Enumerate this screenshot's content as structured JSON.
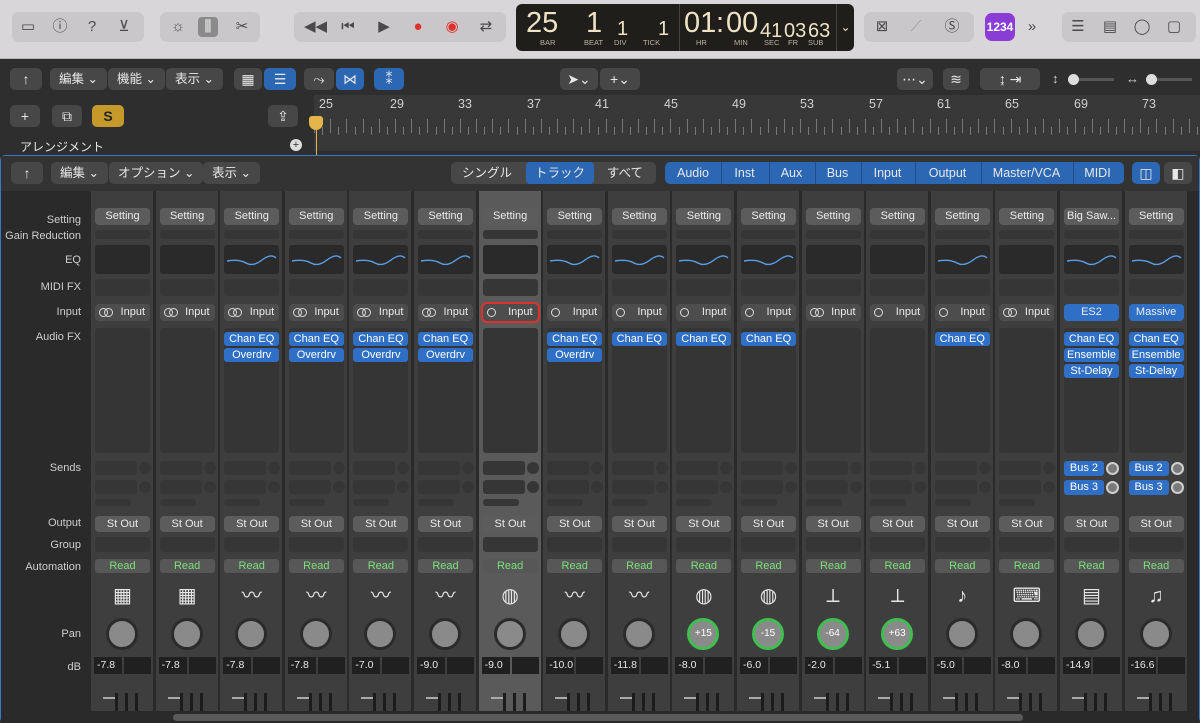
{
  "toolbar": {
    "lcd": {
      "bar": "25",
      "beat": "1",
      "div": "1",
      "tick": "1",
      "hr": "01",
      "min": "00",
      "sec": "41",
      "fr": "03",
      "sub": "63",
      "bar_lbl": "BAR",
      "beat_lbl": "BEAT",
      "div_lbl": "DIV",
      "tick_lbl": "TICK",
      "hr_lbl": "HR",
      "min_lbl": "MIN",
      "sec_lbl": "SEC",
      "fr_lbl": "FR",
      "sub_lbl": "SUB"
    },
    "badge": "1234"
  },
  "tracks": {
    "edit_label": "編集",
    "functions_label": "機能",
    "view_label": "表示",
    "arrangement_label": "アレンジメント",
    "solo_label": "S",
    "ruler": [
      "25",
      "29",
      "33",
      "37",
      "41",
      "45",
      "49",
      "53",
      "57",
      "61",
      "65",
      "69",
      "73"
    ]
  },
  "mixer": {
    "edit_label": "編集",
    "options_label": "オプション",
    "view_label": "表示",
    "scope": [
      "シングル",
      "トラック",
      "すべて"
    ],
    "filters": [
      "Audio",
      "Inst",
      "Aux",
      "Bus",
      "Input",
      "Output",
      "Master/VCA",
      "MIDI"
    ],
    "row_labels": {
      "setting": "Setting",
      "gain": "Gain Reduction",
      "eq": "EQ",
      "midifx": "MIDI FX",
      "input": "Input",
      "audiofx": "Audio FX",
      "sends": "Sends",
      "output": "Output",
      "group": "Group",
      "automation": "Automation",
      "pan": "Pan",
      "db": "dB"
    },
    "strips": [
      {
        "setting": "Setting",
        "input": "Input",
        "stereo": true,
        "fx": [],
        "output": "St Out",
        "auto": "Read",
        "icon": "drum-machine",
        "pan": "",
        "db": "-7.8",
        "eq": false
      },
      {
        "setting": "Setting",
        "input": "Input",
        "stereo": true,
        "fx": [],
        "output": "St Out",
        "auto": "Read",
        "icon": "drum-machine",
        "pan": "",
        "db": "-7.8",
        "eq": false
      },
      {
        "setting": "Setting",
        "input": "Input",
        "stereo": true,
        "fx": [
          "Chan EQ",
          "Overdrv"
        ],
        "output": "St Out",
        "auto": "Read",
        "icon": "waveform",
        "pan": "",
        "db": "-7.8",
        "eq": true
      },
      {
        "setting": "Setting",
        "input": "Input",
        "stereo": true,
        "fx": [
          "Chan EQ",
          "Overdrv"
        ],
        "output": "St Out",
        "auto": "Read",
        "icon": "waveform",
        "pan": "",
        "db": "-7.8",
        "eq": true
      },
      {
        "setting": "Setting",
        "input": "Input",
        "stereo": true,
        "fx": [
          "Chan EQ",
          "Overdrv"
        ],
        "output": "St Out",
        "auto": "Read",
        "icon": "waveform",
        "pan": "",
        "db": "-7.0",
        "eq": true
      },
      {
        "setting": "Setting",
        "input": "Input",
        "stereo": true,
        "fx": [
          "Chan EQ",
          "Overdrv"
        ],
        "output": "St Out",
        "auto": "Read",
        "icon": "waveform",
        "pan": "",
        "db": "-9.0",
        "eq": true
      },
      {
        "setting": "Setting",
        "input": "Input",
        "stereo": false,
        "fx": [],
        "output": "St Out",
        "auto": "Read",
        "icon": "drum",
        "pan": "",
        "db": "-9.0",
        "eq": false,
        "selected": true
      },
      {
        "setting": "Setting",
        "input": "Input",
        "stereo": false,
        "fx": [
          "Chan EQ",
          "Overdrv"
        ],
        "output": "St Out",
        "auto": "Read",
        "icon": "waveform",
        "pan": "",
        "db": "-10.0",
        "eq": true
      },
      {
        "setting": "Setting",
        "input": "Input",
        "stereo": false,
        "fx": [
          "Chan EQ"
        ],
        "output": "St Out",
        "auto": "Read",
        "icon": "waveform",
        "pan": "",
        "db": "-11.8",
        "eq": true
      },
      {
        "setting": "Setting",
        "input": "Input",
        "stereo": false,
        "fx": [
          "Chan EQ"
        ],
        "output": "St Out",
        "auto": "Read",
        "icon": "drum",
        "pan": "+15",
        "db": "-8.0",
        "eq": true
      },
      {
        "setting": "Setting",
        "input": "Input",
        "stereo": false,
        "fx": [
          "Chan EQ"
        ],
        "output": "St Out",
        "auto": "Read",
        "icon": "drum",
        "pan": "-15",
        "db": "-6.0",
        "eq": true
      },
      {
        "setting": "Setting",
        "input": "Input",
        "stereo": true,
        "fx": [],
        "output": "St Out",
        "auto": "Read",
        "icon": "cymbal",
        "pan": "-64",
        "db": "-2.0",
        "eq": false
      },
      {
        "setting": "Setting",
        "input": "Input",
        "stereo": false,
        "fx": [],
        "output": "St Out",
        "auto": "Read",
        "icon": "cymbal",
        "pan": "+63",
        "db": "-5.1",
        "eq": false
      },
      {
        "setting": "Setting",
        "input": "Input",
        "stereo": false,
        "fx": [
          "Chan EQ"
        ],
        "output": "St Out",
        "auto": "Read",
        "icon": "guitar",
        "pan": "",
        "db": "-5.0",
        "eq": true
      },
      {
        "setting": "Setting",
        "input": "Input",
        "stereo": true,
        "fx": [],
        "output": "St Out",
        "auto": "Read",
        "icon": "keyboard",
        "pan": "",
        "db": "-8.0",
        "eq": false
      },
      {
        "setting": "Big Saw...",
        "input": "ES2",
        "instrument": true,
        "fx": [
          "Chan EQ",
          "Ensemble",
          "St-Delay"
        ],
        "sends": [
          "Bus 2",
          "Bus 3"
        ],
        "output": "St Out",
        "auto": "Read",
        "icon": "synth",
        "pan": "",
        "db": "-14.9",
        "eq": true
      },
      {
        "setting": "Setting",
        "input": "Massive",
        "instrument": true,
        "fx": [
          "Chan EQ",
          "Ensemble",
          "St-Delay"
        ],
        "sends": [
          "Bus 2",
          "Bus 3"
        ],
        "output": "St Out",
        "auto": "Read",
        "icon": "music-note",
        "pan": "",
        "db": "-16.6",
        "eq": true
      }
    ]
  }
}
